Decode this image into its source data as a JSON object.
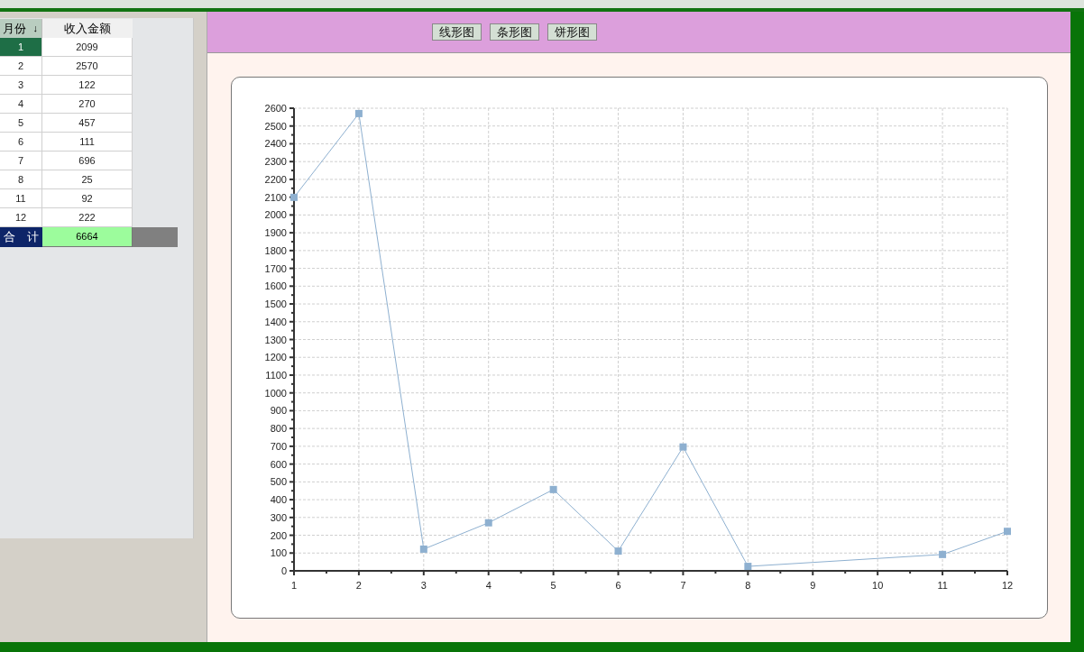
{
  "table": {
    "columns": [
      {
        "label": "月份",
        "sort_arrow": "↓"
      },
      {
        "label": "收入金额"
      }
    ],
    "rows": [
      {
        "month": "1",
        "amount": "2099",
        "selected": true
      },
      {
        "month": "2",
        "amount": "2570",
        "selected": false
      },
      {
        "month": "3",
        "amount": "122",
        "selected": false
      },
      {
        "month": "4",
        "amount": "270",
        "selected": false
      },
      {
        "month": "5",
        "amount": "457",
        "selected": false
      },
      {
        "month": "6",
        "amount": "111",
        "selected": false
      },
      {
        "month": "7",
        "amount": "696",
        "selected": false
      },
      {
        "month": "8",
        "amount": "25",
        "selected": false
      },
      {
        "month": "11",
        "amount": "92",
        "selected": false
      },
      {
        "month": "12",
        "amount": "222",
        "selected": false
      }
    ],
    "total": {
      "label": "合　计",
      "value": "6664"
    }
  },
  "toolbar": {
    "buttons": [
      "线形图",
      "条形图",
      "饼形图"
    ]
  },
  "chart": {
    "chart_data": {
      "type": "line",
      "x": [
        1,
        2,
        3,
        4,
        5,
        6,
        7,
        8,
        11,
        12
      ],
      "grid": true,
      "series": [
        {
          "color": "#8eb0d0",
          "marker": "square",
          "values": [
            2099,
            2570,
            122,
            270,
            457,
            111,
            696,
            25,
            92,
            222
          ]
        }
      ],
      "xlim": [
        1,
        12
      ],
      "ylim": [
        0,
        2600
      ],
      "xticks": [
        1,
        2,
        3,
        4,
        5,
        6,
        7,
        8,
        9,
        10,
        11,
        12
      ],
      "yticks": [
        0,
        100,
        200,
        300,
        400,
        500,
        600,
        700,
        800,
        900,
        1000,
        1100,
        1200,
        1300,
        1400,
        1500,
        1600,
        1700,
        1800,
        1900,
        2000,
        2100,
        2200,
        2300,
        2400,
        2500,
        2600
      ]
    }
  }
}
